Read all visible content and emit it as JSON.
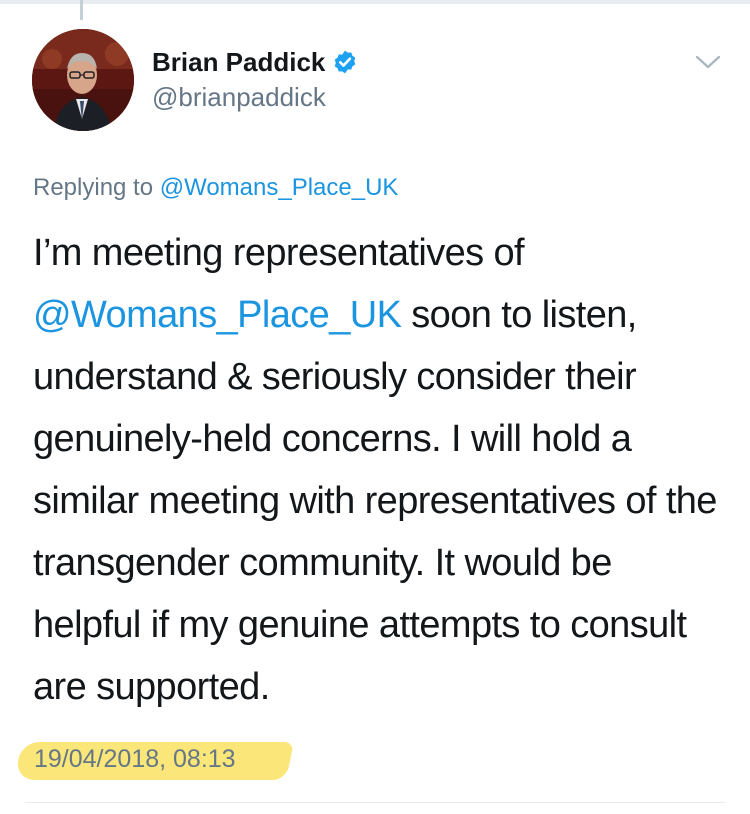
{
  "author": {
    "display_name": "Brian Paddick",
    "handle": "@brianpaddick",
    "verified": true,
    "avatar_icon": "avatar-photo"
  },
  "reply": {
    "prefix": "Replying to",
    "mention": "@Womans_Place_UK"
  },
  "tweet": {
    "text_part1": "I’m meeting representatives of ",
    "mention": "@Womans_Place_UK",
    "text_part2": " soon to listen, understand & seriously consider their genuinely-held concerns. I will hold a similar meeting with representatives of the transgender community. It would be helpful if my genuine attempts to consult are supported.",
    "timestamp": "19/04/2018, 08:13"
  },
  "colors": {
    "link": "#1b95e0",
    "muted": "#657786",
    "text": "#14171a",
    "highlight": "#fbe36a"
  },
  "icons": {
    "verified": "verified-badge-icon",
    "menu": "chevron-down-icon"
  }
}
